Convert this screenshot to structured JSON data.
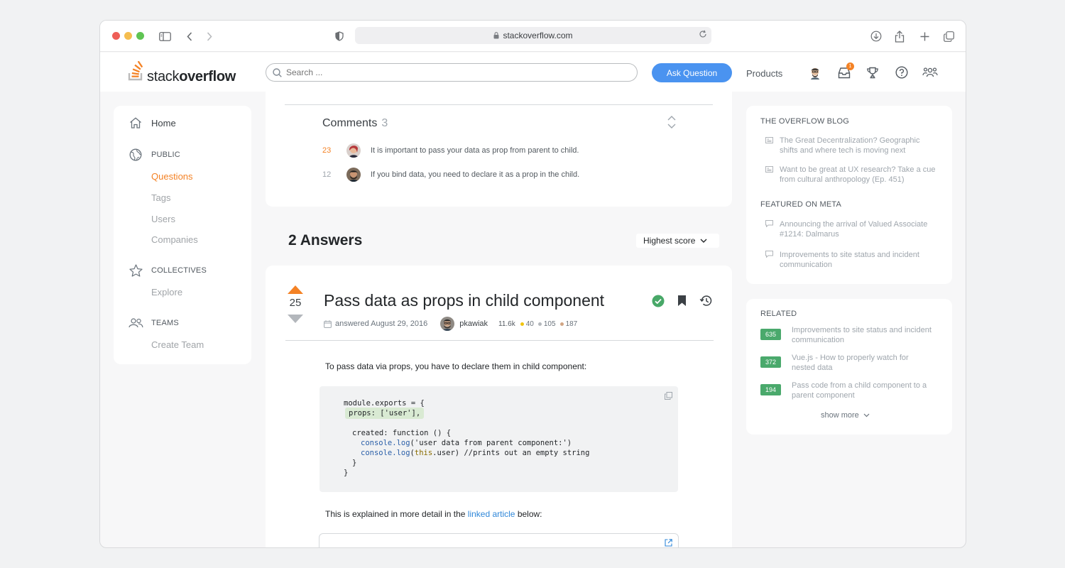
{
  "browser": {
    "url": "stackoverflow.com"
  },
  "header": {
    "logo_light": "stack",
    "logo_bold": "overflow",
    "search_placeholder": "Search ...",
    "ask_label": "Ask Question",
    "products_label": "Products",
    "inbox_badge": "1"
  },
  "leftnav": {
    "home": "Home",
    "public": "PUBLIC",
    "questions": "Questions",
    "tags": "Tags",
    "users": "Users",
    "companies": "Companies",
    "collectives": "COLLECTIVES",
    "explore": "Explore",
    "teams": "TEAMS",
    "create_team": "Create Team"
  },
  "comments": {
    "title": "Comments",
    "count": "3",
    "items": [
      {
        "score": "23",
        "text": "It is important to pass your data as prop from parent to child."
      },
      {
        "score": "12",
        "text": "If you bind data, you need to declare it as a prop in the child."
      }
    ]
  },
  "answers": {
    "heading": "2 Answers",
    "sort_label": "Highest score"
  },
  "answer": {
    "votes": "25",
    "title": "Pass data as props in child component",
    "answered": "answered August 29, 2016",
    "author": "pkawiak",
    "reputation": "11.6k",
    "gold": "40",
    "silver": "105",
    "bronze": "187",
    "intro": "To pass data via props, you have to declare them in child component:",
    "code": {
      "l1": "module.exports = {",
      "l2": "props: ['user'],",
      "l3": "created: function () {",
      "l4_fn": "console.log",
      "l4_rest": "('user data from parent component:')",
      "l5_fn": "console.log",
      "l5_open": "(",
      "l5_kw": "this",
      "l5_rest": ".user) //prints out an empty string",
      "l6": "}",
      "l7": "}"
    },
    "outro_before": "This is explained in more detail in the ",
    "outro_link": "linked article",
    "outro_after": " below:"
  },
  "blog": {
    "heading": "THE OVERFLOW BLOG",
    "items": [
      "The Great Decentralization? Geographic shifts and where tech is moving next",
      "Want to be great at UX research? Take a cue from cultural anthropology (Ep. 451)"
    ],
    "meta_heading": "FEATURED ON META",
    "meta_items": [
      "Announcing the arrival of Valued Associate #1214: Dalmarus",
      "Improvements to site status and incident communication"
    ]
  },
  "related": {
    "heading": "RELATED",
    "items": [
      {
        "score": "635",
        "text": "Improvements to site status and incident communication"
      },
      {
        "score": "372",
        "text": "Vue.js - How to properly watch for nested data"
      },
      {
        "score": "194",
        "text": "Pass code from a child component to a parent component"
      }
    ],
    "show_more": "show more"
  },
  "colors": {
    "accent": "#f48225",
    "primary": "#4a93f0",
    "accepted": "#48a868",
    "related_badge": "#4aa96c"
  }
}
